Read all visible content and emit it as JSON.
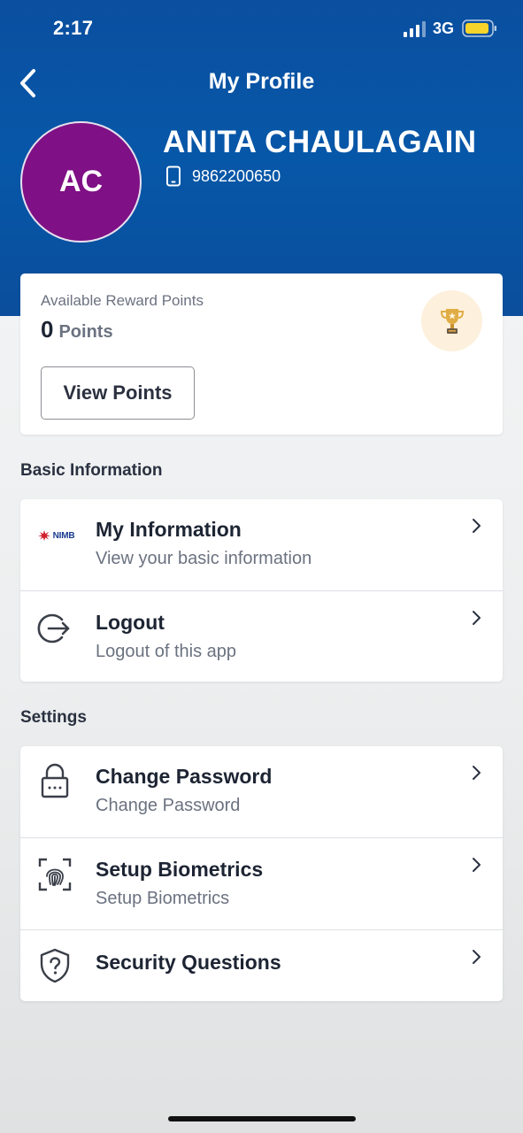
{
  "status_bar": {
    "time": "2:17",
    "network": "3G"
  },
  "header": {
    "title": "My Profile"
  },
  "profile": {
    "initials": "AC",
    "name": "ANITA CHAULAGAIN",
    "phone": "9862200650",
    "avatar_color": "#7f1085"
  },
  "rewards": {
    "label": "Available Reward Points",
    "value": "0",
    "unit": "Points",
    "button_label": "View Points"
  },
  "basic_information": {
    "heading": "Basic Information",
    "items": [
      {
        "title": "My Information",
        "subtitle": "View your basic information",
        "icon": "nimb-logo-icon",
        "logo_text": "NIMB"
      },
      {
        "title": "Logout",
        "subtitle": "Logout of this app",
        "icon": "logout-icon"
      }
    ]
  },
  "settings": {
    "heading": "Settings",
    "items": [
      {
        "title": "Change Password",
        "subtitle": "Change Password",
        "icon": "lock-icon"
      },
      {
        "title": "Setup Biometrics",
        "subtitle": "Setup Biometrics",
        "icon": "fingerprint-icon"
      },
      {
        "title": "Security Questions",
        "icon": "shield-question-icon"
      }
    ]
  },
  "colors": {
    "header_blue": "#0757a8",
    "trophy_bg": "#fdf0dc",
    "trophy_gold": "#d9a53a"
  }
}
